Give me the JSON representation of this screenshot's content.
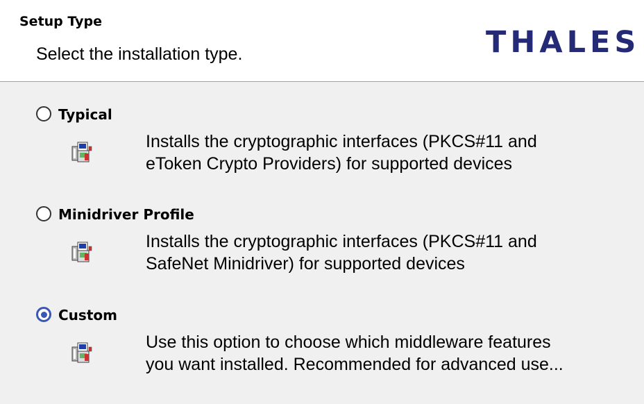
{
  "header": {
    "title": "Setup Type",
    "subtitle": "Select the installation type.",
    "logo_text": "THALES"
  },
  "options": [
    {
      "label": "Typical",
      "line1": "Installs the cryptographic interfaces (PKCS#11 and",
      "line2": "eToken Crypto Providers) for supported devices",
      "selected": false,
      "icon": "installer-package-icon"
    },
    {
      "label": "Minidriver Profile",
      "line1": "Installs the cryptographic interfaces (PKCS#11 and",
      "line2": "SafeNet Minidriver) for supported devices",
      "selected": false,
      "icon": "installer-package-icon"
    },
    {
      "label": "Custom",
      "line1": "Use this option to choose which middleware features",
      "line2": "you want installed. Recommended for advanced use...",
      "selected": true,
      "icon": "installer-package-icon"
    }
  ],
  "colors": {
    "accent": "#3b57b4",
    "logo": "#242a75",
    "panel_bg": "#f0f0f0",
    "header_bg": "#ffffff"
  }
}
